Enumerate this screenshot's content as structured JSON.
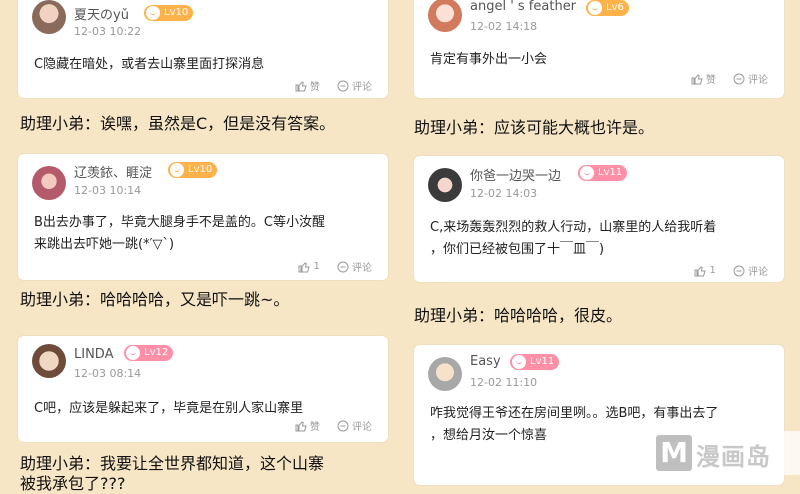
{
  "comments": [
    {
      "user": "夏天のyǔ",
      "level": "Lv10",
      "date": "12-03 10:22",
      "text": "C隐藏在暗处，或者去山寨里面打探消息",
      "like_label": "赞",
      "reply_label": "评论",
      "like_count": ""
    },
    {
      "user": "辽羡銥、睚淀",
      "level": "Lv10",
      "date": "12-03 10:14",
      "text_lines": [
        "B出去办事了，毕竟大腿身手不是盖的。C等小汝醒",
        "来跳出去吓她一跳(*′▽`)"
      ],
      "like_count": "1",
      "reply_label": "评论"
    },
    {
      "user": "LINDA",
      "level": "Lv12",
      "date": "12-03 08:14",
      "text": "C吧，应该是躲起来了，毕竟是在别人家山寨里",
      "like_label": "赞",
      "reply_label": "评论"
    },
    {
      "user": "angel ' s feather",
      "level": "Lv6",
      "date": "12-02 14:18",
      "text": "肯定有事外出一小会",
      "like_label": "赞",
      "reply_label": "评论"
    },
    {
      "user": "你爸一边哭一边",
      "level": "Lv11",
      "date": "12-02 14:03",
      "text_lines": [
        "C,来场轰轰烈烈的救人行动，山寨里的人给我听着",
        "，你们已经被包围了十￣皿￣)"
      ],
      "like_count": "1",
      "reply_label": "评论"
    },
    {
      "user": "Easy",
      "level": "Lv11",
      "date": "12-02 11:10",
      "text_lines": [
        "咋我觉得王爷还在房间里咧。。选B吧，有事出去了",
        "，想给月汝一个惊喜"
      ]
    }
  ],
  "narration": [
    "助理小弟：诶嘿，虽然是C，但是没有答案。",
    "助理小弟：哈哈哈哈，又是吓一跳~。",
    "助理小弟：我要让全世界都知道，这个山寨",
    "被我承包了???",
    "助理小弟：应该可能大概也许是。",
    "助理小弟：哈哈哈哈，很皮。"
  ],
  "watermark": {
    "letter": "M",
    "text": "漫画岛"
  }
}
